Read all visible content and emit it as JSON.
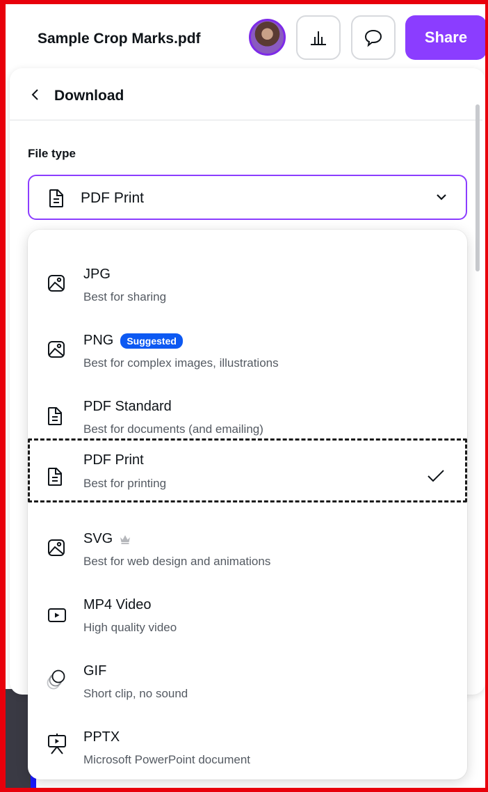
{
  "topbar": {
    "document_title": "Sample Crop Marks.pdf",
    "share_label": "Share",
    "icons": [
      "avatar",
      "chart-bars-icon",
      "comment-icon"
    ]
  },
  "panel": {
    "title": "Download",
    "file_type_label": "File type",
    "selected_value": "PDF Print"
  },
  "options": [
    {
      "title": "JPG",
      "desc": "Best for sharing",
      "icon": "image-icon"
    },
    {
      "title": "PNG",
      "badge": "Suggested",
      "desc": "Best for complex images, illustrations",
      "icon": "image-icon"
    },
    {
      "title": "PDF Standard",
      "desc": "Best for documents (and emailing)",
      "icon": "document-icon"
    },
    {
      "title": "PDF Print",
      "desc": "Best for printing",
      "icon": "document-icon",
      "selected": true
    },
    {
      "title": "SVG",
      "desc": "Best for web design and animations",
      "icon": "image-icon",
      "premium": true
    },
    {
      "title": "MP4 Video",
      "desc": "High quality video",
      "icon": "video-icon"
    },
    {
      "title": "GIF",
      "desc": "Short clip, no sound",
      "icon": "gif-icon"
    },
    {
      "title": "PPTX",
      "desc": "Microsoft PowerPoint document",
      "icon": "presentation-icon"
    }
  ],
  "colors": {
    "accent": "#8b3dff",
    "badge": "#0d59f2",
    "frame": "#e8000b"
  }
}
